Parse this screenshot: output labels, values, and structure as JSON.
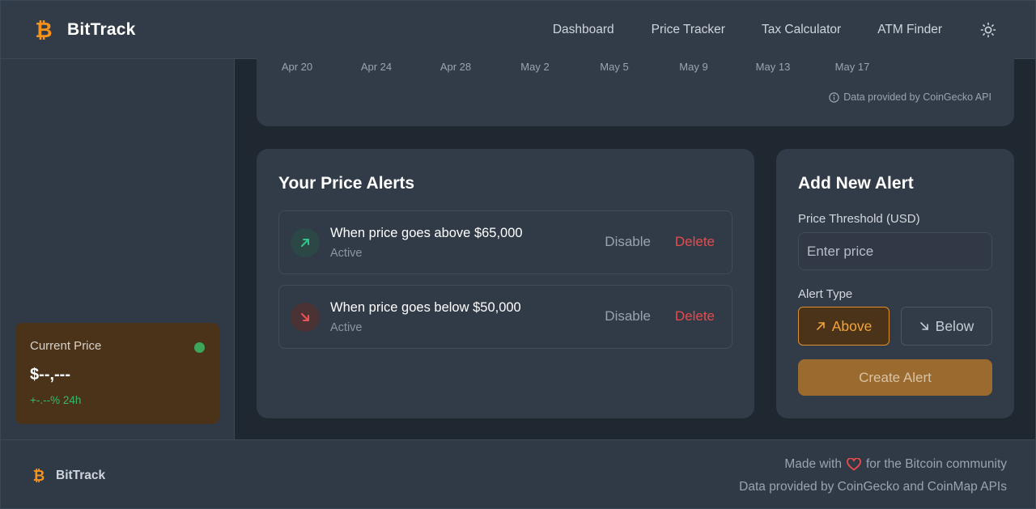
{
  "header": {
    "logo_text": "BitTrack",
    "nav": [
      "Dashboard",
      "Price Tracker",
      "Tax Calculator",
      "ATM Finder"
    ],
    "theme_icon": "sun-icon"
  },
  "sidebar": {
    "current_price": {
      "label": "Current Price",
      "value": "$--,---",
      "change": "+-.--% 24h",
      "status_color": "#3ea65a"
    }
  },
  "chart": {
    "x_ticks": [
      "Apr 20",
      "Apr 24",
      "Apr 28",
      "May 2",
      "May 5",
      "May 9",
      "May 13",
      "May 17"
    ],
    "source_note": "Data provided by CoinGecko API"
  },
  "alerts": {
    "title": "Your Price Alerts",
    "items": [
      {
        "text": "When price goes above $65,000",
        "status": "Active",
        "direction": "up",
        "disable_label": "Disable",
        "delete_label": "Delete"
      },
      {
        "text": "When price goes below $50,000",
        "status": "Active",
        "direction": "down",
        "disable_label": "Disable",
        "delete_label": "Delete"
      }
    ]
  },
  "add_alert": {
    "title": "Add New Alert",
    "threshold_label": "Price Threshold (USD)",
    "threshold_placeholder": "Enter price",
    "type_label": "Alert Type",
    "above_label": "Above",
    "below_label": "Below",
    "selected_type": "Above",
    "create_label": "Create Alert"
  },
  "footer": {
    "logo_text": "BitTrack",
    "made_prefix": "Made with",
    "made_suffix": "for the Bitcoin community",
    "data_note": "Data provided by CoinGecko and CoinMap APIs"
  },
  "colors": {
    "accent": "#f7931a",
    "danger": "#e84b4b",
    "success": "#3ea65a"
  }
}
